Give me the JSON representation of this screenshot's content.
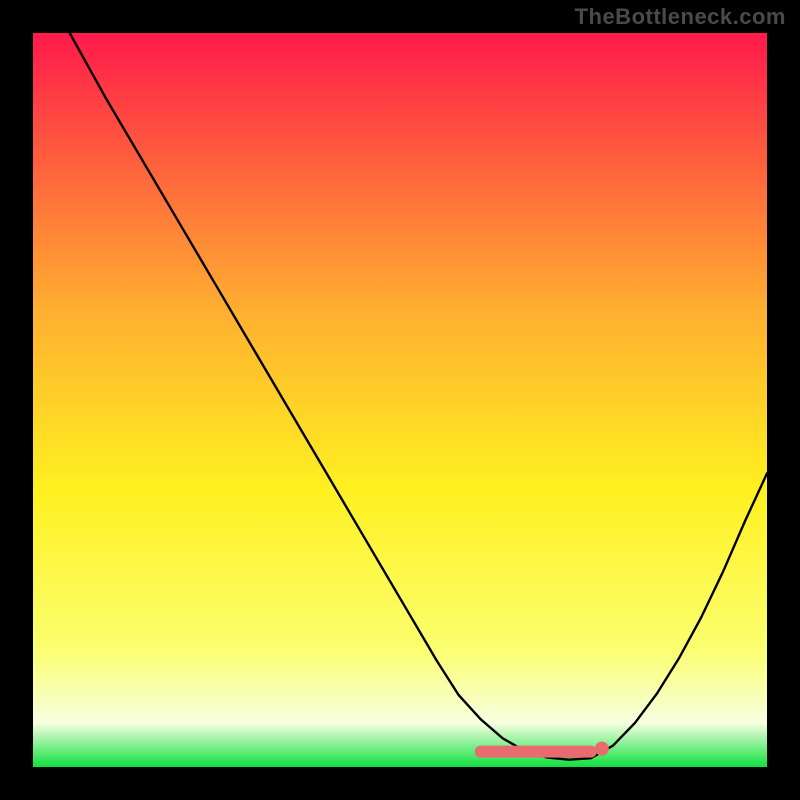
{
  "watermark": "TheBottleneck.com",
  "colors": {
    "background": "#000000",
    "watermark": "#4a4a4a",
    "curve": "#000000",
    "marker_fill": "#e86b6f",
    "marker_stroke": "#e86b6f",
    "gradient_top": "#ff1a4a",
    "gradient_mid1": "#ffb030",
    "gradient_mid2": "#fff020",
    "gradient_yellow": "#fbff70",
    "gradient_pale": "#f7ffe0",
    "gradient_green": "#10e040"
  },
  "chart_data": {
    "type": "line",
    "title": "",
    "xlabel": "",
    "ylabel": "",
    "xlim": [
      0,
      100
    ],
    "ylim": [
      0,
      100
    ],
    "grid": false,
    "legend": false,
    "series": [
      {
        "name": "bottleneck-curve",
        "x": [
          5,
          10,
          15,
          20,
          25,
          30,
          35,
          40,
          45,
          50,
          55,
          58,
          61,
          64,
          67,
          70,
          73,
          76,
          79,
          82,
          85,
          88,
          91,
          94,
          97,
          100
        ],
        "y": [
          100,
          91,
          82.5,
          74,
          65.5,
          57,
          48.5,
          40,
          31.5,
          23,
          14.5,
          9.8,
          6.5,
          3.9,
          2.2,
          1.3,
          1.0,
          1.2,
          2.9,
          6.0,
          10.0,
          14.8,
          20.3,
          26.6,
          33.5,
          40.0
        ]
      }
    ],
    "markers": [
      {
        "name": "flat-minimum-band",
        "kind": "hband",
        "x_start": 61,
        "x_end": 76,
        "y": 2.1
      },
      {
        "name": "min-end-dot",
        "kind": "dot",
        "x": 77.5,
        "y": 2.5
      }
    ]
  }
}
